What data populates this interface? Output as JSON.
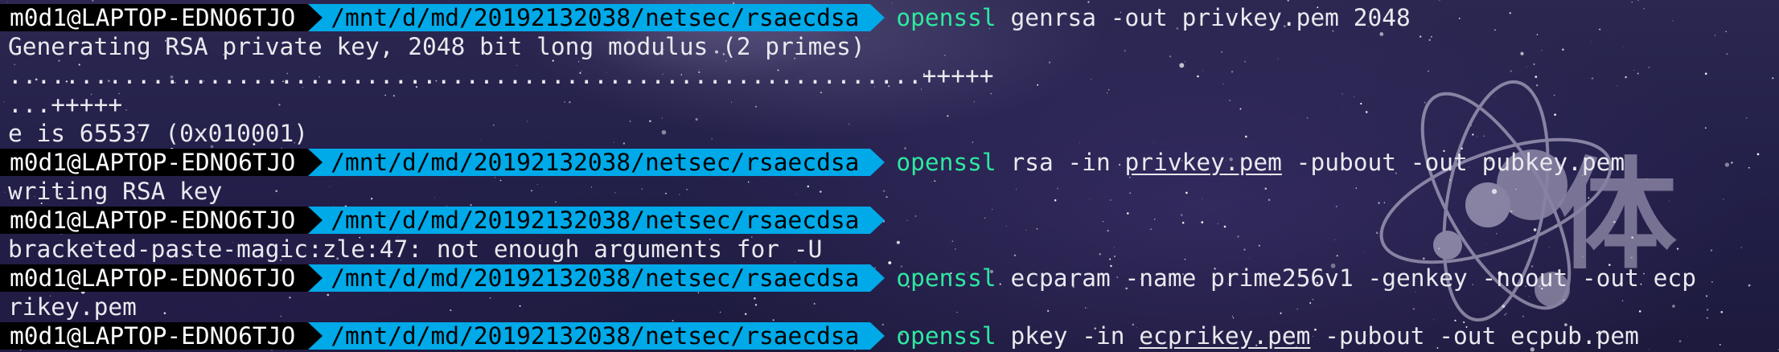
{
  "prompt": {
    "user_host": "m0d1@LAPTOP-EDNO6TJO",
    "path": "/mnt/d/md/20192132038/netsec/rsaecdsa"
  },
  "colors": {
    "user_segment_bg": "#000000",
    "path_segment_bg": "#00a9e8",
    "command_name": "#2ee8a0",
    "text": "#e9e9ef"
  },
  "watermark": {
    "glyph": "体"
  },
  "lines": [
    {
      "type": "prompt",
      "bin": "openssl",
      "parts": [
        " genrsa -out privkey.pem 2048"
      ]
    },
    {
      "type": "output",
      "text": "Generating RSA private key, 2048 bit long modulus (2 primes)"
    },
    {
      "type": "output",
      "text": "................................................................+++++"
    },
    {
      "type": "output",
      "text": "...+++++"
    },
    {
      "type": "output",
      "text": "e is 65537 (0x010001)"
    },
    {
      "type": "prompt",
      "bin": "openssl",
      "parts": [
        " rsa -in ",
        "privkey.pem",
        " -pubout -out pubkey.pem"
      ]
    },
    {
      "type": "output",
      "text": "writing RSA key"
    },
    {
      "type": "prompt",
      "bin": "",
      "parts": []
    },
    {
      "type": "output",
      "text": "bracketed-paste-magic:zle:47: not enough arguments for -U"
    },
    {
      "type": "prompt",
      "bin": "openssl",
      "parts": [
        " ecparam -name prime256v1 -genkey -noout -out ecp"
      ]
    },
    {
      "type": "output",
      "text": "rikey.pem"
    },
    {
      "type": "prompt",
      "bin": "openssl",
      "parts": [
        " pkey -in ",
        "ecprikey.pem",
        " -pubout -out ecpub.pem"
      ]
    }
  ]
}
